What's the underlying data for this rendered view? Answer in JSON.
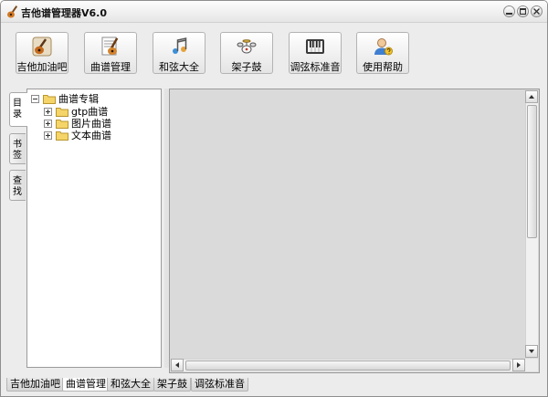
{
  "window": {
    "title": "吉他谱管理器V6.0",
    "buttons": [
      "minimize-icon",
      "restore-icon",
      "close-icon"
    ]
  },
  "toolbar": {
    "buttons": [
      {
        "label": "吉他加油吧",
        "icon": "guitar-badge-icon"
      },
      {
        "label": "曲谱管理",
        "icon": "guitar-sheet-icon"
      },
      {
        "label": "和弦大全",
        "icon": "music-notes-icon"
      },
      {
        "label": "架子鼓",
        "icon": "drum-kit-icon"
      },
      {
        "label": "调弦标准音",
        "icon": "tuner-keyboard-icon"
      },
      {
        "label": "使用帮助",
        "icon": "help-user-icon"
      }
    ]
  },
  "side_tabs": [
    {
      "label": "目录",
      "active": true
    },
    {
      "label": "书签",
      "active": false
    },
    {
      "label": "查找",
      "active": false
    }
  ],
  "tree": {
    "root": {
      "label": "曲谱专辑",
      "expanded": true
    },
    "children": [
      {
        "label": "gtp曲谱",
        "expanded": false
      },
      {
        "label": "图片曲谱",
        "expanded": false
      },
      {
        "label": "文本曲谱",
        "expanded": false
      }
    ]
  },
  "bottom_tabs": [
    {
      "label": "吉他加油吧",
      "active": false
    },
    {
      "label": "曲谱管理",
      "active": true
    },
    {
      "label": "和弦大全",
      "active": false
    },
    {
      "label": "架子鼓",
      "active": false
    },
    {
      "label": "调弦标准音",
      "active": false
    }
  ],
  "colors": {
    "content_bg": "#dadada",
    "folder": "#f5d56a",
    "window_bg": "#ececec"
  }
}
